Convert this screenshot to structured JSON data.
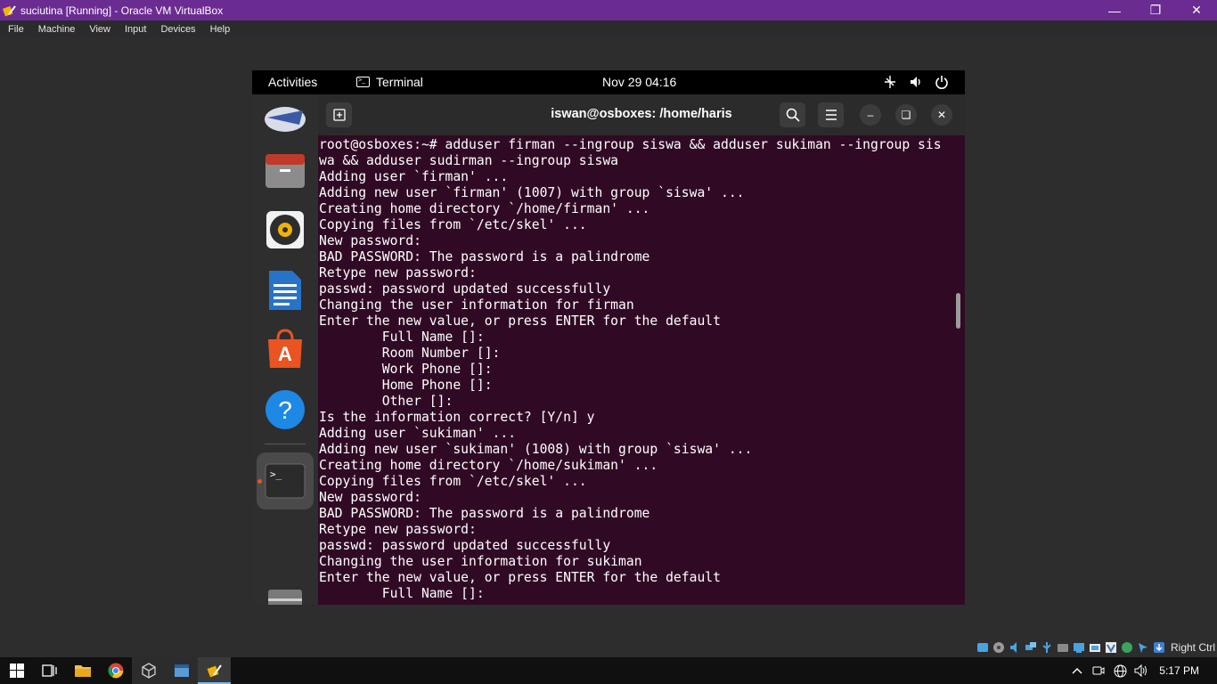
{
  "vbox": {
    "title": "suciutina [Running] - Oracle VM VirtualBox",
    "menu": [
      "File",
      "Machine",
      "View",
      "Input",
      "Devices",
      "Help"
    ],
    "host_key": "Right Ctrl"
  },
  "gnome": {
    "activities": "Activities",
    "app_name": "Terminal",
    "datetime": "Nov 29  04:16",
    "dock": [
      "thunderbird-icon",
      "files-icon",
      "rhythmbox-icon",
      "libreoffice-writer-icon",
      "app-center-icon",
      "help-icon",
      "terminal-icon",
      "trash-icon",
      "show-apps-icon"
    ]
  },
  "terminal": {
    "title": "iswan@osboxes: /home/haris",
    "lines": [
      "root@osboxes:~# adduser firman --ingroup siswa && adduser sukiman --ingroup sis",
      "wa && adduser sudirman --ingroup siswa",
      "Adding user `firman' ...",
      "Adding new user `firman' (1007) with group `siswa' ...",
      "Creating home directory `/home/firman' ...",
      "Copying files from `/etc/skel' ...",
      "New password:",
      "BAD PASSWORD: The password is a palindrome",
      "Retype new password:",
      "passwd: password updated successfully",
      "Changing the user information for firman",
      "Enter the new value, or press ENTER for the default",
      "        Full Name []:",
      "        Room Number []:",
      "        Work Phone []:",
      "        Home Phone []:",
      "        Other []:",
      "Is the information correct? [Y/n] y",
      "Adding user `sukiman' ...",
      "Adding new user `sukiman' (1008) with group `siswa' ...",
      "Creating home directory `/home/sukiman' ...",
      "Copying files from `/etc/skel' ...",
      "New password:",
      "BAD PASSWORD: The password is a palindrome",
      "Retype new password:",
      "passwd: password updated successfully",
      "Changing the user information for sukiman",
      "Enter the new value, or press ENTER for the default",
      "        Full Name []:"
    ]
  },
  "taskbar": {
    "time": "5:17 PM"
  },
  "colors": {
    "vbox_titlebar": "#6a2c91",
    "terminal_bg": "#300a24",
    "ubuntu_orange": "#e95420"
  }
}
